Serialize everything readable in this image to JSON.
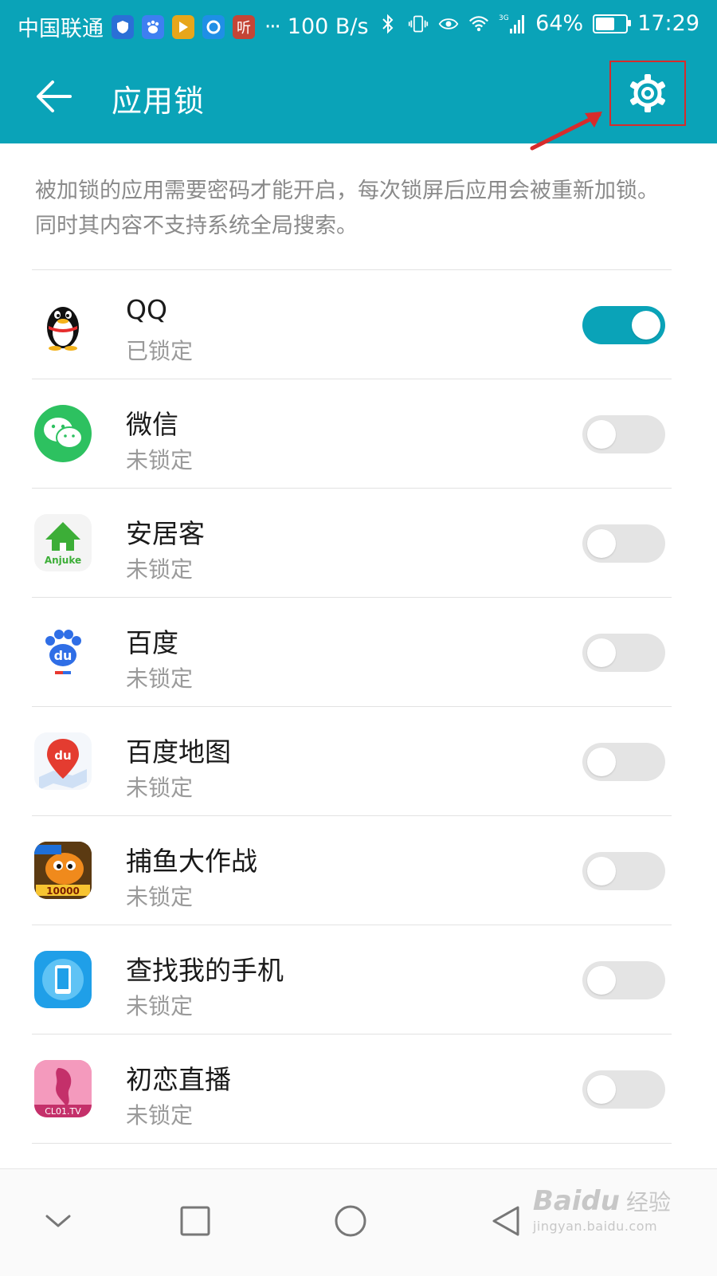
{
  "status_bar": {
    "carrier": "中国联通",
    "notif_ting": "听",
    "overflow": "···",
    "speed": "100 B/s",
    "net_type": "3G",
    "battery": "64%",
    "battery_level": 0.64,
    "time": "17:29"
  },
  "header": {
    "title": "应用锁"
  },
  "description": "被加锁的应用需要密码才能开启，每次锁屏后应用会被重新加锁。同时其内容不支持系统全局搜索。",
  "apps": [
    {
      "name": "QQ",
      "status": "已锁定",
      "locked": true,
      "icon": "qq-penguin-icon"
    },
    {
      "name": "微信",
      "status": "未锁定",
      "locked": false,
      "icon": "wechat-icon"
    },
    {
      "name": "安居客",
      "status": "未锁定",
      "locked": false,
      "icon": "anjuke-icon",
      "icon_text": "Anjuke"
    },
    {
      "name": "百度",
      "status": "未锁定",
      "locked": false,
      "icon": "baidu-icon",
      "icon_text": "du"
    },
    {
      "name": "百度地图",
      "status": "未锁定",
      "locked": false,
      "icon": "baidu-map-icon",
      "icon_text": "du"
    },
    {
      "name": "捕鱼大作战",
      "status": "未锁定",
      "locked": false,
      "icon": "fishing-game-icon",
      "icon_text": "10000"
    },
    {
      "name": "查找我的手机",
      "status": "未锁定",
      "locked": false,
      "icon": "find-phone-icon"
    },
    {
      "name": "初恋直播",
      "status": "未锁定",
      "locked": false,
      "icon": "chulian-live-icon",
      "icon_text": "CL01.TV"
    }
  ],
  "watermark": {
    "logo": "Baidu",
    "cn": "经验",
    "url": "jingyan.baidu.com"
  },
  "colors": {
    "accent": "#0aa3b8",
    "annotation": "#d72b2b",
    "toggle_off": "#e4e4e4"
  }
}
